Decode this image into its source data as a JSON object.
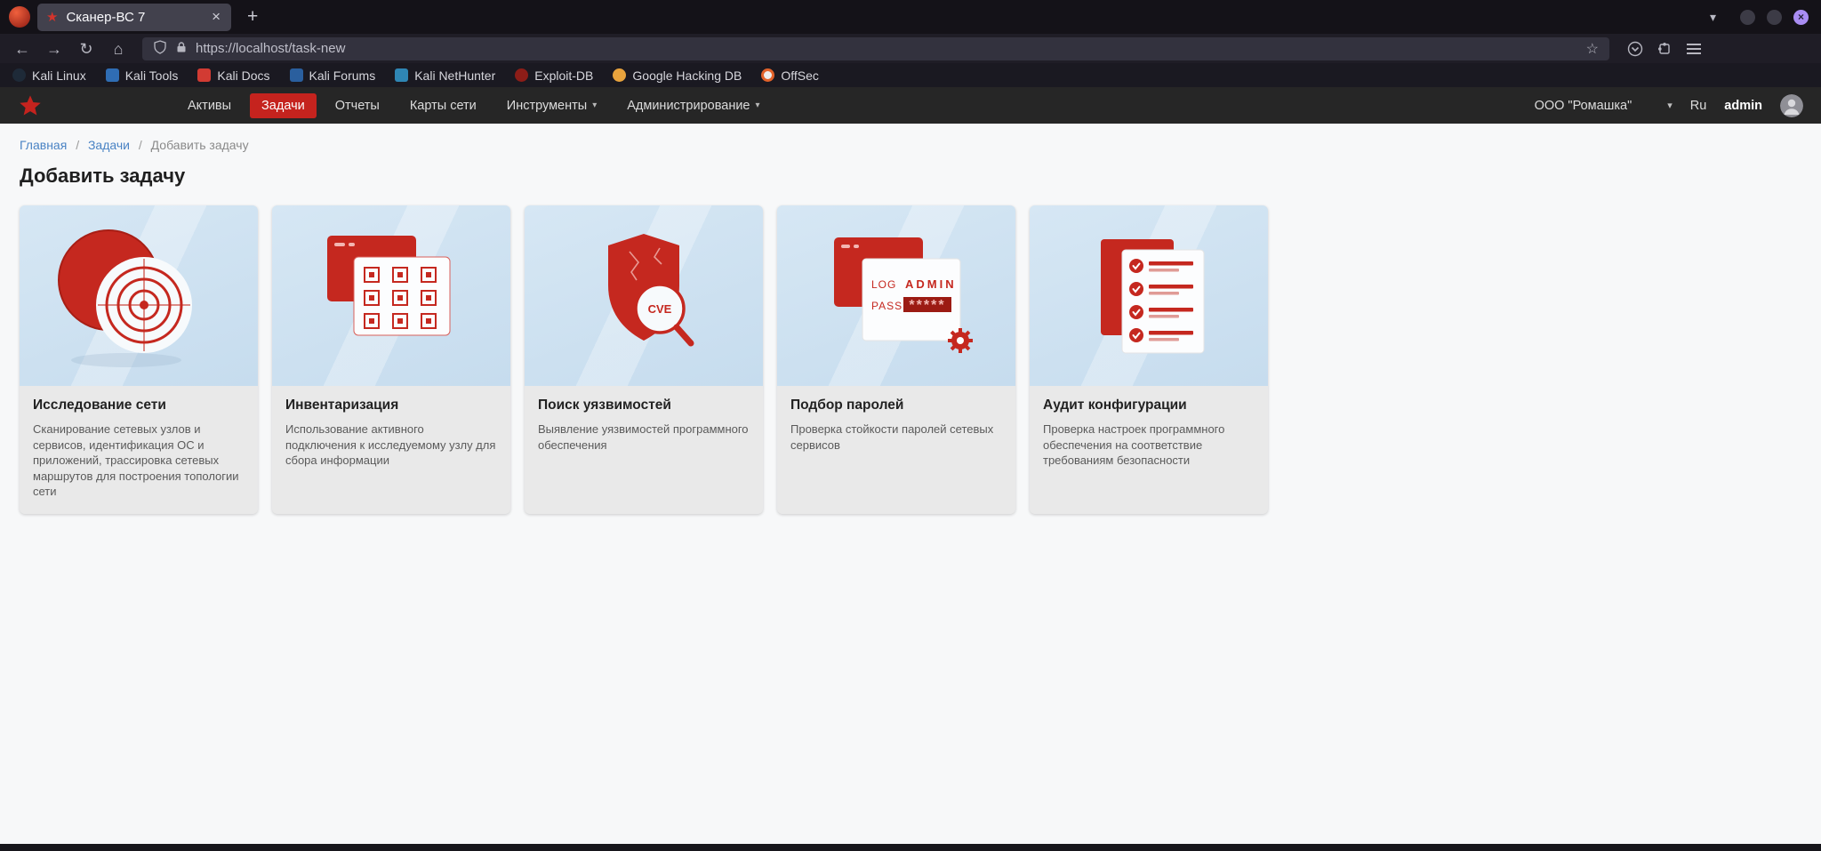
{
  "colors": {
    "accent_red": "#c5231e",
    "illustration_red": "#c5281f",
    "link_blue": "#4a83c4",
    "card_illustration_bg": "#cfe2f0",
    "card_body_bg": "#e9e9e9",
    "close_button_purple": "#a98df3"
  },
  "icons": {
    "star_filled": "★",
    "star_outline": "☆",
    "close": "×",
    "plus": "+",
    "back": "←",
    "forward": "→",
    "reload": "↻",
    "home": "⌂",
    "chevron_down": "▾"
  },
  "browser": {
    "tab_title": "Сканер-ВС 7",
    "url": "https://localhost/task-new",
    "bookmarks": [
      {
        "label": "Kali Linux"
      },
      {
        "label": "Kali Tools"
      },
      {
        "label": "Kali Docs"
      },
      {
        "label": "Kali Forums"
      },
      {
        "label": "Kali NetHunter"
      },
      {
        "label": "Exploit-DB"
      },
      {
        "label": "Google Hacking DB"
      },
      {
        "label": "OffSec"
      }
    ]
  },
  "navbar": {
    "items": [
      {
        "label": "Активы"
      },
      {
        "label": "Задачи"
      },
      {
        "label": "Отчеты"
      },
      {
        "label": "Карты сети"
      },
      {
        "label": "Инструменты"
      },
      {
        "label": "Администрирование"
      }
    ],
    "org": "ООО \"Ромашка\"",
    "lang": "Ru",
    "user": "admin"
  },
  "breadcrumb": {
    "separator": "/",
    "items": [
      {
        "label": "Главная"
      },
      {
        "label": "Задачи"
      },
      {
        "label": "Добавить задачу"
      }
    ]
  },
  "page": {
    "title": "Добавить задачу"
  },
  "cards": [
    {
      "title": "Исследование сети",
      "description": "Сканирование сетевых узлов и сервисов, идентификация ОС и приложений, трассировка сетевых маршрутов для построения топологии сети"
    },
    {
      "title": "Инвентаризация",
      "description": "Использование активного подключения к исследуемому узлу для сбора информации"
    },
    {
      "title": "Поиск уязвимостей",
      "description": "Выявление уязвимостей программного обеспечения"
    },
    {
      "title": "Подбор паролей",
      "description": "Проверка стойкости паролей сетевых сервисов"
    },
    {
      "title": "Аудит конфигурации",
      "description": "Проверка настроек программного обеспечения на соответствие требованиям безопасности"
    }
  ],
  "illustrations": {
    "cve_label": "CVE",
    "login_label": "LOG",
    "admin_value": "ADMIN",
    "password_label": "PASS",
    "password_value": "*****"
  }
}
